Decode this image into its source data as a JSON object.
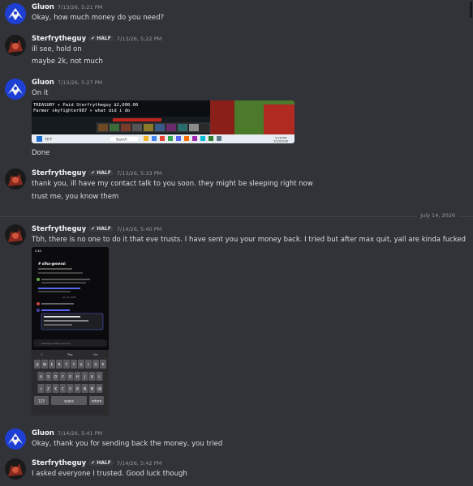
{
  "messages": [
    {
      "user": "Gluon",
      "time": "7/13/26, 5:21 PM",
      "lines": [
        "Okay, how much money do you need?"
      ]
    },
    {
      "user": "Sterfrytheguy",
      "tag": "HALF",
      "time": "7/13/26, 5:22 PM",
      "lines": [
        "ill see, hold on",
        "maybe 2k, not much"
      ]
    },
    {
      "user": "Gluon",
      "time": "7/13/26, 5:27 PM",
      "lines": [
        "On it",
        "Done"
      ]
    },
    {
      "user": "Sterfrytheguy",
      "tag": "HALF",
      "time": "7/13/26, 5:33 PM",
      "lines": [
        "thank you, ill have my contact talk to you soon. they might be sleeping right now",
        "trust me, you know them"
      ]
    },
    {
      "user": "Sterfrytheguy",
      "tag": "HALF",
      "time": "7/14/26, 5:40 PM",
      "lines": [
        "Tbh, there is no one to do it that eve trusts. I have sent you your money back. I tried but after max quit, yall are kinda fucked"
      ]
    },
    {
      "user": "Gluon",
      "time": "7/14/26, 5:41 PM",
      "lines": [
        "Okay, thank you for sending back the money, you tried"
      ]
    },
    {
      "user": "Sterfrytheguy",
      "tag": "HALF",
      "time": "7/14/26, 5:42 PM",
      "lines": [
        "I asked everyone I trusted. Good luck though"
      ]
    }
  ],
  "date_divider": "July 14, 2026",
  "game_screenshot": {
    "chat_line1": "TREASURY ✦ Paid Sterfrytheguy $2,000.00",
    "chat_line2": "Farmer skyfighter987 » what did i do",
    "taskbar_search": "Search",
    "taskbar_time": "5:26 PM",
    "taskbar_date": "7/13/2026",
    "weather": "76°F"
  },
  "phone_screenshot": {
    "status_time": "5:40",
    "channel": "# ofha-general",
    "divider": "July 14, 2026",
    "input_placeholder": "Message #ofha-general",
    "suggestions": [
      "I",
      "The",
      "I'm"
    ],
    "keyboard_rows": [
      [
        "Q",
        "W",
        "E",
        "R",
        "T",
        "Y",
        "U",
        "I",
        "O",
        "P"
      ],
      [
        "A",
        "S",
        "D",
        "F",
        "G",
        "H",
        "J",
        "K",
        "L"
      ],
      [
        "⇧",
        "Z",
        "X",
        "C",
        "V",
        "B",
        "N",
        "M",
        "⌫"
      ],
      [
        "123",
        "space",
        "return"
      ]
    ]
  }
}
